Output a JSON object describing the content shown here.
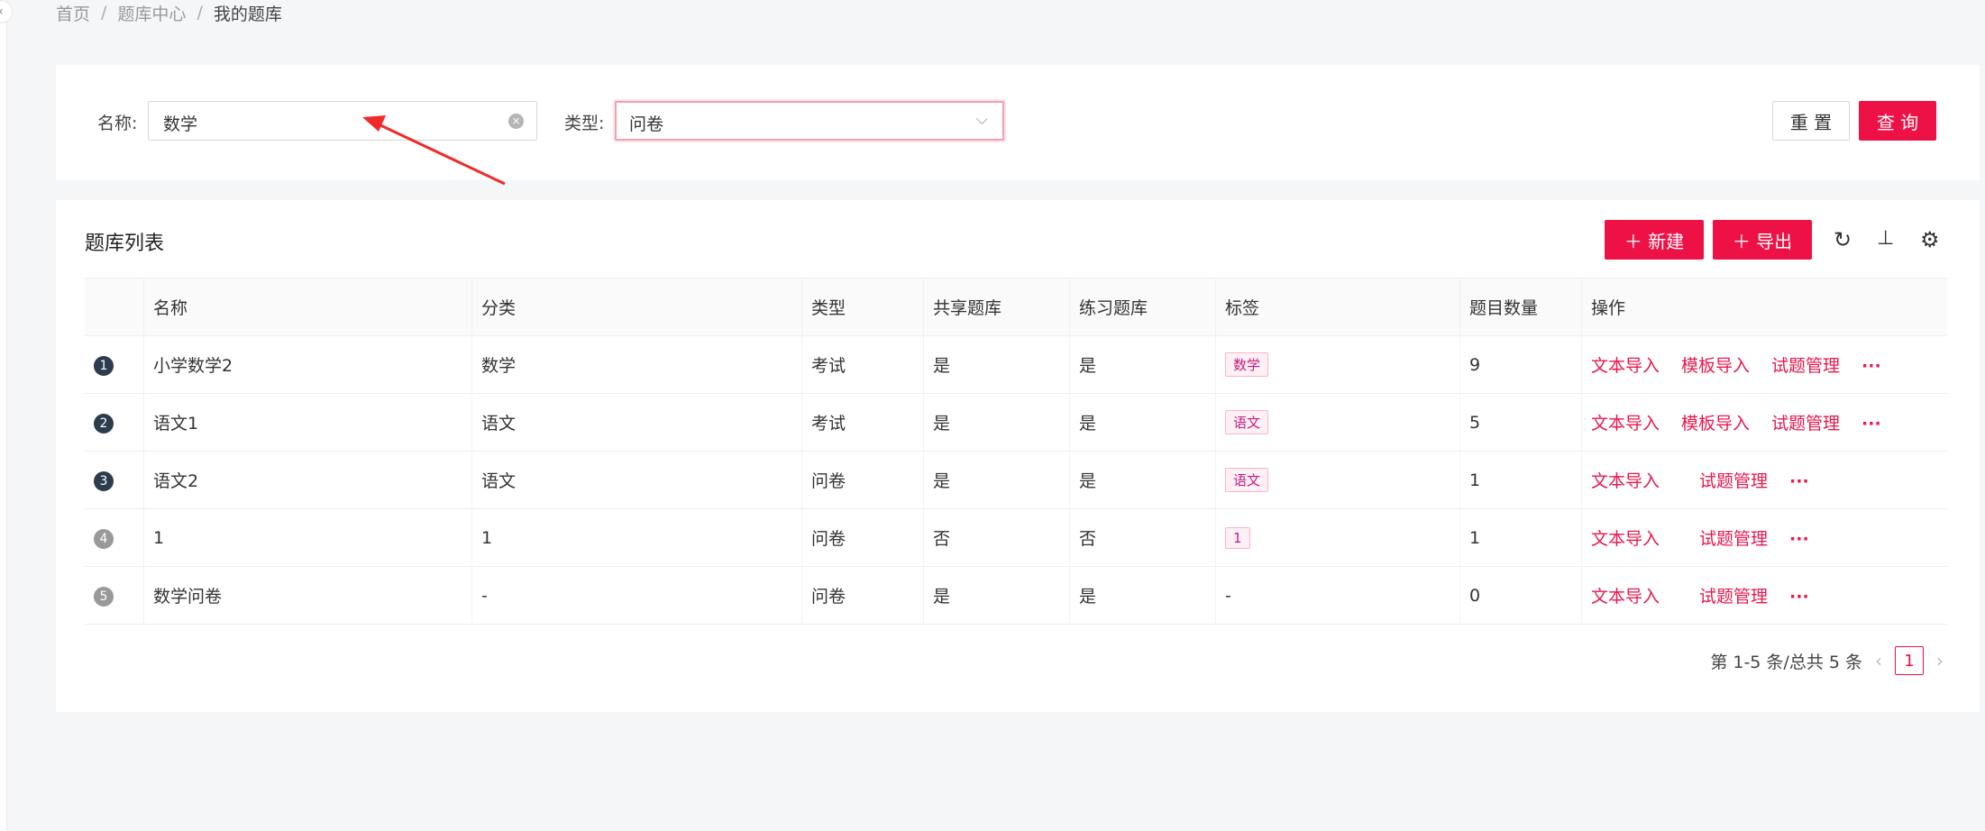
{
  "breadcrumb": [
    "首页",
    "题库中心",
    "我的题库"
  ],
  "filters": {
    "name_label": "名称:",
    "name_value": "数学",
    "type_label": "类型:",
    "type_value": "问卷",
    "reset_label": "重 置",
    "query_label": "查 询"
  },
  "table_card": {
    "title": "题库列表",
    "new_label": "＋ 新建",
    "export_label": "＋ 导出",
    "icons": [
      "refresh-icon",
      "column-height-icon",
      "settings-icon"
    ]
  },
  "table": {
    "columns": [
      "",
      "名称",
      "分类",
      "类型",
      "共享题库",
      "练习题库",
      "标签",
      "题目数量",
      "操作"
    ],
    "rows": [
      {
        "index": "1",
        "name": "小学数学2",
        "category": "数学",
        "type": "考试",
        "shared": "是",
        "practice": "是",
        "tag": "数学",
        "count": "9",
        "actions": [
          "文本导入",
          "模板导入",
          "试题管理"
        ],
        "more": "···"
      },
      {
        "index": "2",
        "name": "语文1",
        "category": "语文",
        "type": "考试",
        "shared": "是",
        "practice": "是",
        "tag": "语文",
        "count": "5",
        "actions": [
          "文本导入",
          "模板导入",
          "试题管理"
        ],
        "more": "···"
      },
      {
        "index": "3",
        "name": "语文2",
        "category": "语文",
        "type": "问卷",
        "shared": "是",
        "practice": "是",
        "tag": "语文",
        "count": "1",
        "actions": [
          "文本导入",
          "试题管理"
        ],
        "more": "···"
      },
      {
        "index": "4",
        "name": "1",
        "category": "1",
        "type": "问卷",
        "shared": "否",
        "practice": "否",
        "tag": "1",
        "count": "1",
        "actions": [
          "文本导入",
          "试题管理"
        ],
        "more": "···"
      },
      {
        "index": "5",
        "name": "数学问卷",
        "category": "-",
        "type": "问卷",
        "shared": "是",
        "practice": "是",
        "tag": "-",
        "count": "0",
        "actions": [
          "文本导入",
          "试题管理"
        ],
        "more": "···"
      }
    ]
  },
  "pagination": {
    "summary": "第 1-5 条/总共 5 条",
    "current_page": "1"
  },
  "colors": {
    "primary": "#ee1146",
    "link": "#e8184e",
    "tag_text": "#c41d7f",
    "annotation_arrow": "#f02a2a"
  }
}
